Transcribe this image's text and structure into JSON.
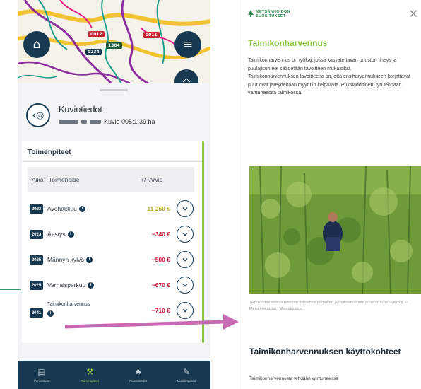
{
  "left_phone": {
    "map": {
      "tags": [
        "0012",
        "1304",
        "0011",
        "0234"
      ],
      "home_icon": "home-icon",
      "menu_icon": "menu-icon"
    },
    "sheet": {
      "title": "Kuviotiedot",
      "subtitle_suffix": "Kuvio 005;1,39 ha",
      "back_icon": "back-circle-icon"
    },
    "card": {
      "title": "Toimenpiteet",
      "columns": [
        "Aika",
        "Toimenpide",
        "+/- Arvio"
      ],
      "rows": [
        {
          "year": "2023",
          "operation": "Avohakkuu",
          "value": "11 260 €",
          "value_color": "#b5a82e"
        },
        {
          "year": "2023",
          "operation": "Äestys",
          "value": "−340 €",
          "value_color": "#cf1d3f"
        },
        {
          "year": "2025",
          "operation": "Männyn kylvö",
          "value": "−500 €",
          "value_color": "#cf1d3f"
        },
        {
          "year": "2025",
          "operation": "Varhaisperkuu",
          "value": "−670 €",
          "value_color": "#cf1d3f"
        },
        {
          "year": "2041",
          "operation": "Taimikonharvennus",
          "value": "−710 €",
          "value_color": "#cf1d3f"
        }
      ]
    },
    "nav": [
      {
        "label": "Perustiedot",
        "icon": "building-icon"
      },
      {
        "label": "Toimenpiteet",
        "icon": "axe-icon"
      },
      {
        "label": "Puustotiedot",
        "icon": "tree-icon"
      },
      {
        "label": "Muistiinpanot",
        "icon": "edit-icon"
      }
    ]
  },
  "right_phone": {
    "logo_line1": "METSÄNHOIDON",
    "logo_line2": "SUOSITUKSET",
    "close_icon": "close-icon",
    "title": "Taimikonharvennus",
    "body": [
      "Taimikonharvennus on työkaj, jossa kasvatettavan puuston tiheys ja puulajisuhteet säädetään tavoitteen mukaisiksi.",
      "Taimikonharvennuksen tavoitteena on, että ensiharvennukseen korjattavat puut ovat järeydeltään myyntiin kelpaavia. Puksiadditioeni työ tehdään varttuneessa taimikossa."
    ],
    "photo_caption": "Taimikonharvennus tehdään ostoallinsi parhaiten ja taukoamatonta puuston kasvun Kuva: © Mervi Heinäkuu / Metsäkeskus",
    "section_title": "Taimikonharvennuksen käyttökohteet",
    "section_body": "Taimikonharvennusta tehdään varttuneessa"
  },
  "accent_colors": {
    "navy": "#173a52",
    "green": "#8dc63f",
    "arrow": "#c86ab4",
    "negative": "#cf1d3f"
  }
}
